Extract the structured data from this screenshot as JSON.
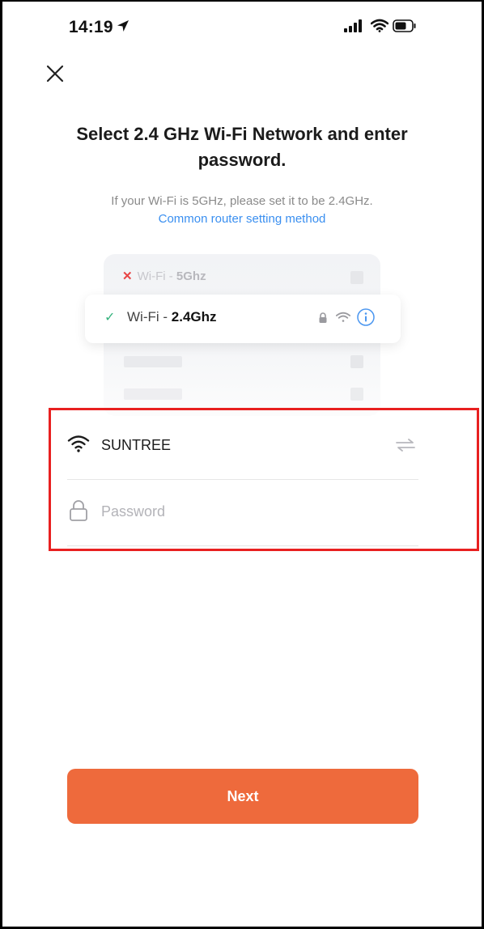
{
  "status_bar": {
    "time": "14:19",
    "icons": [
      "location-arrow-icon",
      "signal-icon",
      "wifi-icon",
      "battery-icon"
    ]
  },
  "header": {
    "close_icon": "close-icon",
    "title": "Select 2.4 GHz Wi-Fi Network and enter password.",
    "hint": "If your Wi-Fi is 5GHz, please set it to be 2.4GHz.",
    "link": "Common router setting method"
  },
  "illustration": {
    "bad_network": {
      "prefix": "Wi-Fi - ",
      "band": "5Ghz",
      "status_icon": "cross-icon"
    },
    "good_network": {
      "prefix": "Wi-Fi - ",
      "band": "2.4Ghz",
      "status_icon": "check-icon"
    }
  },
  "form": {
    "ssid": "SUNTREE",
    "password_placeholder": "Password",
    "password_value": ""
  },
  "actions": {
    "next_label": "Next"
  },
  "colors": {
    "accent": "#ee6a3c",
    "link": "#3a8ff0",
    "highlight_border": "#e82020",
    "check": "#36b37e",
    "cross": "#e84545"
  }
}
